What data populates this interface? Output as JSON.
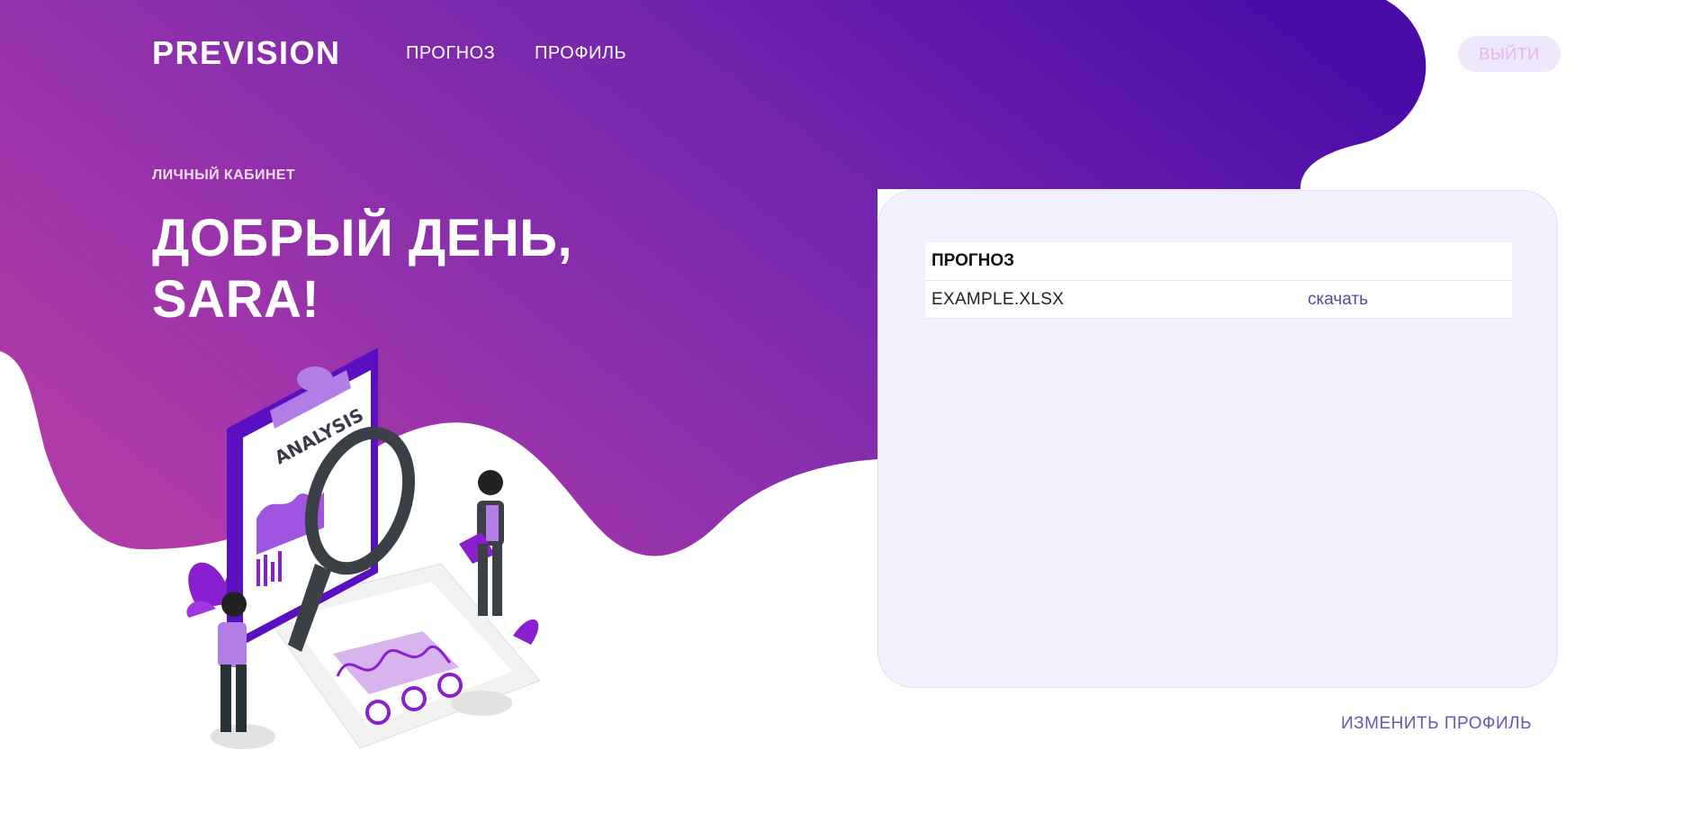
{
  "nav": {
    "logo": "PREVISION",
    "links": [
      {
        "label": "ПРОГНОЗ"
      },
      {
        "label": "ПРОФИЛЬ"
      }
    ],
    "logout_label": "ВЫЙТИ"
  },
  "hero": {
    "eyebrow": "ЛИЧНЫЙ КАБИНЕТ",
    "greeting_line1": "ДОБРЫЙ ДЕНЬ,",
    "greeting_line2": "SARA!"
  },
  "illustration": {
    "sign_text": "ANALYSIS",
    "icon": "analysis-illustration"
  },
  "forecast_table": {
    "header": "ПРОГНОЗ",
    "rows": [
      {
        "file": "EXAMPLE.XLSX",
        "action": "скачать"
      }
    ]
  },
  "edit_profile_label": "ИЗМЕНИТЬ ПРОФИЛЬ",
  "colors": {
    "gradient_start": "#b03aa8",
    "gradient_end": "#4a0ba8",
    "card_bg": "#f2f1fe",
    "link": "#6a55b8"
  }
}
